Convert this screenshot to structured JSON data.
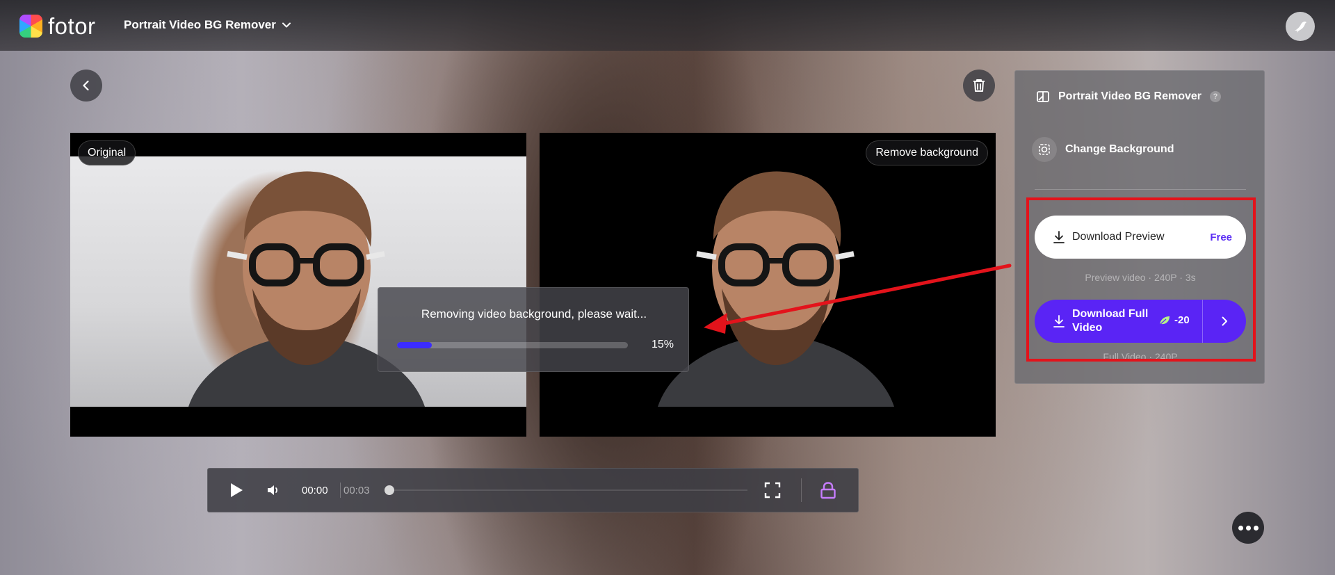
{
  "app": {
    "brand": "fotor",
    "tool_name": "Portrait Video BG Remover"
  },
  "video": {
    "original_label": "Original",
    "result_label": "Remove background"
  },
  "progress": {
    "message": "Removing video background, please wait...",
    "percent_label": "15%",
    "percent_value": 15
  },
  "side_panel": {
    "tool_name": "Portrait Video BG Remover",
    "help_glyph": "?",
    "change_background_label": "Change Background",
    "download_preview": {
      "label": "Download Preview",
      "badge": "Free",
      "caption": "Preview video · 240P · 3s"
    },
    "download_full": {
      "label": "Download Full Video",
      "credits": "-20",
      "caption": "Full Video · 240P"
    }
  },
  "player": {
    "current_time": "00:00",
    "duration": "00:03",
    "position_fraction": 0
  },
  "colors": {
    "accent": "#5a24f5",
    "progress_fill": "#3b2cff",
    "free_badge": "#5a2cf5",
    "annotation_red": "#e3131b",
    "lock_icon": "#c77dff",
    "leaf_icon": "#b6f08a"
  },
  "icons": {
    "back": "chevron-left-icon",
    "delete": "trash-icon",
    "download": "download-icon",
    "credits": "leaf-icon",
    "more": "more-dots-icon",
    "fullscreen": "fullscreen-icon",
    "lock": "lock-icon",
    "play": "play-icon",
    "volume": "volume-icon"
  }
}
